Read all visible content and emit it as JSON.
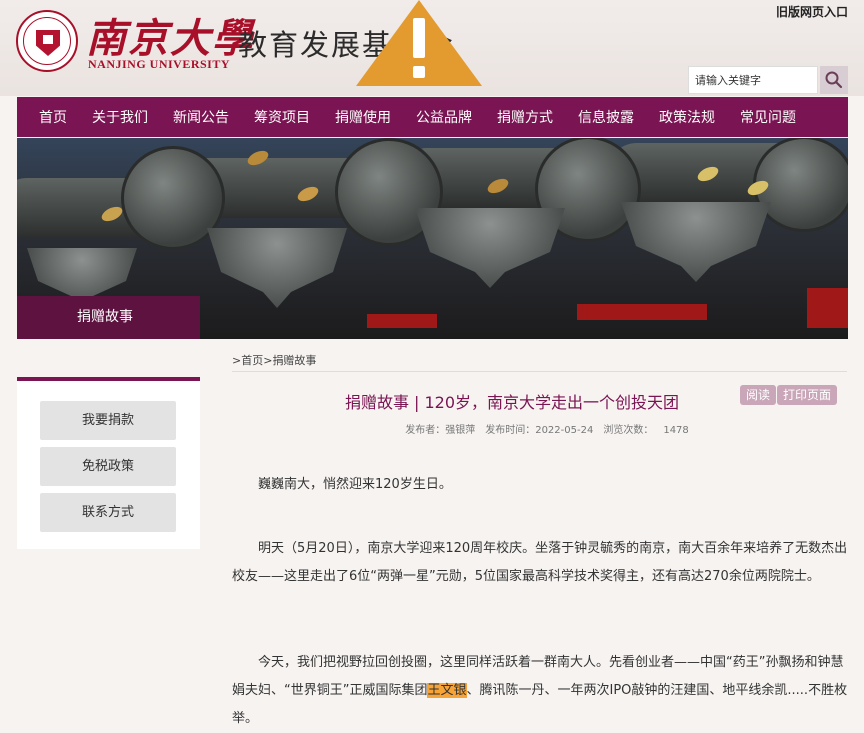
{
  "header": {
    "logo_cn": "南京大學",
    "logo_en": "NANJING UNIVERSITY",
    "site_title": "教育发展基金会",
    "old_version_link": "旧版网页入口",
    "search_placeholder": "请输入关键字"
  },
  "nav": [
    "首页",
    "关于我们",
    "新闻公告",
    "筹资项目",
    "捐赠使用",
    "公益品牌",
    "捐赠方式",
    "信息披露",
    "政策法规",
    "常见问题"
  ],
  "banner": {
    "label": "捐赠故事"
  },
  "sidebar": {
    "items": [
      "我要捐款",
      "免税政策",
      "联系方式"
    ]
  },
  "breadcrumb": {
    "home": "首页",
    "current": "捐赠故事"
  },
  "article": {
    "title": "捐赠故事 | 120岁，南京大学走出一个创投天团",
    "read_button": "阅读",
    "print_button": "打印页面",
    "meta": {
      "publisher_label": "发布者：",
      "publisher": "强银萍",
      "time_label": "发布时间：",
      "time": "2022-05-24",
      "views_label": "浏览次数：",
      "views": "1478"
    },
    "p1": "巍巍南大，悄然迎来120岁生日。",
    "p2": "明天（5月20日），南京大学迎来120周年校庆。坐落于钟灵毓秀的南京，南大百余年来培养了无数杰出校友——这里走出了6位“两弹一星”元勋，5位国家最高科学技术奖得主，还有高达270余位两院院士。",
    "p3_before": "今天，我们把视野拉回创投圈，这里同样活跃着一群南大人。先看创业者——中国“药王”孙飘扬和钟慧娟夫妇、“世界铜王”正威国际集团",
    "p3_highlight": "王文银",
    "p3_after": "、腾讯陈一丹、一年两次IPO敲钟的汪建国、地平线余凯.....不胜枚举。"
  },
  "colors": {
    "brand": "#7a1452",
    "logo_red": "#a8102a",
    "warning": "#e39b30",
    "highlight": "#f7a335"
  }
}
